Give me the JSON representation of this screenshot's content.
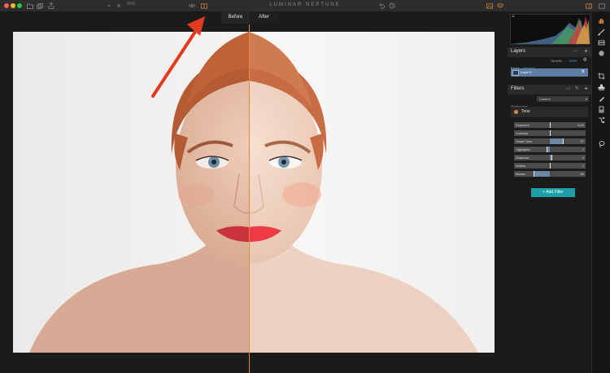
{
  "app": {
    "title": "LUMINAR NEPTUNE"
  },
  "toolbar": {
    "zoom": "56%"
  },
  "compare": {
    "before_label": "Before",
    "after_label": "After"
  },
  "layers": {
    "title": "Layers",
    "blend_label": "Blend:",
    "blend_value": "Normal",
    "opacity_label": "Opacity:",
    "opacity_value": "100%",
    "layer_name": "Layer 0"
  },
  "filters": {
    "title": "Filters",
    "workspace_label": "Workspace:",
    "workspace_value": "Custom",
    "tone_label": "Tone",
    "sliders": [
      {
        "label": "Exposure",
        "value": "0.00",
        "fraction": 0.5
      },
      {
        "label": "Contrast",
        "value": "",
        "fraction": 0.5
      },
      {
        "label": "Smart Tone",
        "value": "37",
        "fraction": 0.68
      },
      {
        "label": "Highlights",
        "value": "-7",
        "fraction": 0.46
      },
      {
        "label": "Shadows",
        "value": "4",
        "fraction": 0.52
      },
      {
        "label": "Whites",
        "value": "1",
        "fraction": 0.505
      },
      {
        "label": "Blacks",
        "value": "-46",
        "fraction": 0.27
      }
    ],
    "add_filter_label": "Add Filter"
  },
  "colors": {
    "accent": "#1ea0a9",
    "split_line": "#e08a3c",
    "arrow": "#e23a1f",
    "layer_selected": "#5e7ea6"
  }
}
